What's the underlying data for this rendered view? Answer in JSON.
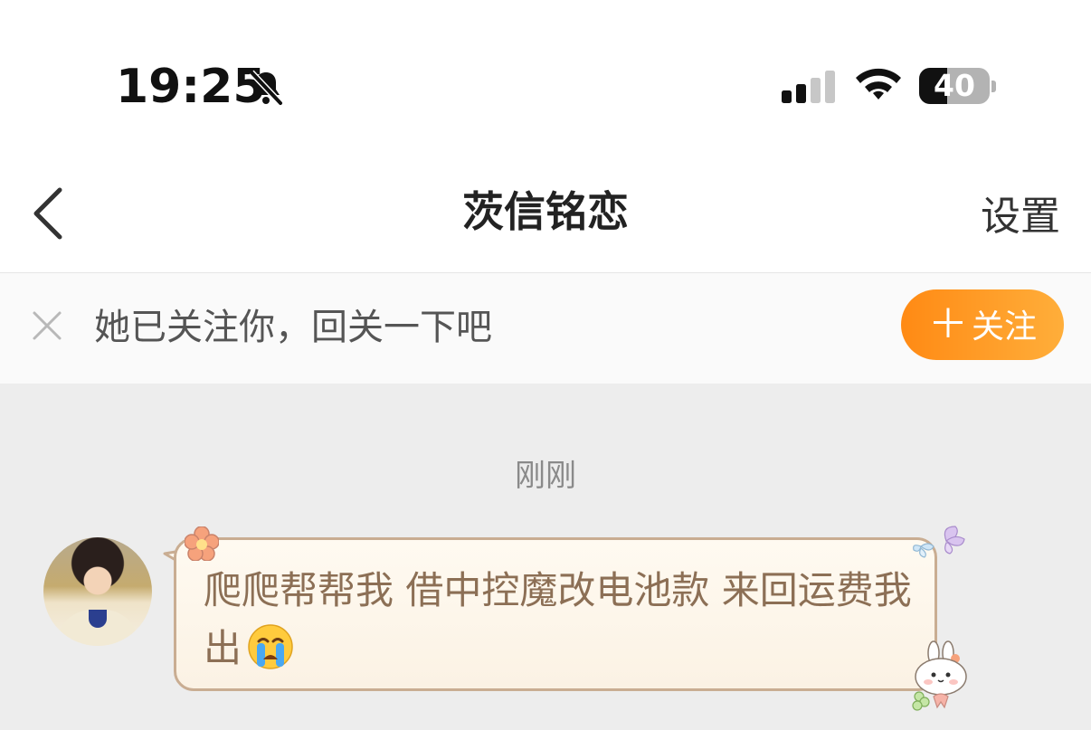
{
  "status": {
    "time": "19:25",
    "battery": 40,
    "battery_label": "40",
    "signal_bars_active": 2,
    "icons": [
      "bell-muted-icon",
      "signal-icon",
      "wifi-icon",
      "battery-icon"
    ]
  },
  "nav": {
    "back_icon": "chevron-left-icon",
    "title": "茨信铭恋",
    "settings_label": "设置"
  },
  "follow_banner": {
    "close_icon": "close-icon",
    "text": "她已关注你，回关一下吧",
    "button_plus": "＋",
    "button_label": "关注",
    "button_color": "#ff8a14"
  },
  "chat": {
    "timestamp": "刚刚",
    "messages": [
      {
        "text": "爬爬帮帮我  借中控魔改电池款 来回运费我出",
        "emoji": "crying-face-emoji",
        "bubble_border": "#c9ad92",
        "text_color": "#8c6f55"
      }
    ]
  }
}
